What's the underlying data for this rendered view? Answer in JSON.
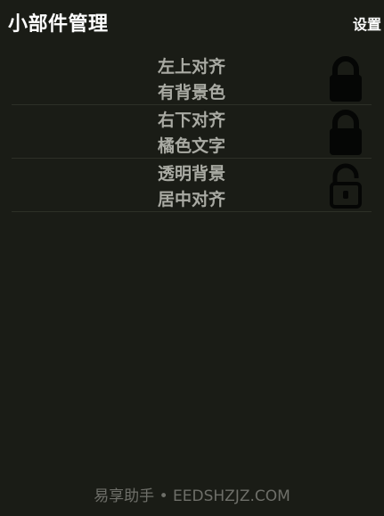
{
  "header": {
    "title": "小部件管理",
    "settings_label": "设置"
  },
  "widgets": [
    {
      "line1": "左上对齐",
      "line2": "有背景色",
      "lock_icon": "lock-closed-icon",
      "locked": true
    },
    {
      "line1": "右下对齐",
      "line2": "橘色文字",
      "lock_icon": "lock-closed-icon",
      "locked": true
    },
    {
      "line1": "透明背景",
      "line2": "居中对齐",
      "lock_icon": "lock-open-icon",
      "locked": false
    }
  ],
  "footer": {
    "watermark": "易享助手 • EEDSHZJZ.COM"
  },
  "colors": {
    "background": "#1a1c16",
    "title": "#ffffff",
    "row_text": "#a9aaa3",
    "divider": "#2d3027",
    "icon": "#050605",
    "footer": "#6e6f69"
  }
}
